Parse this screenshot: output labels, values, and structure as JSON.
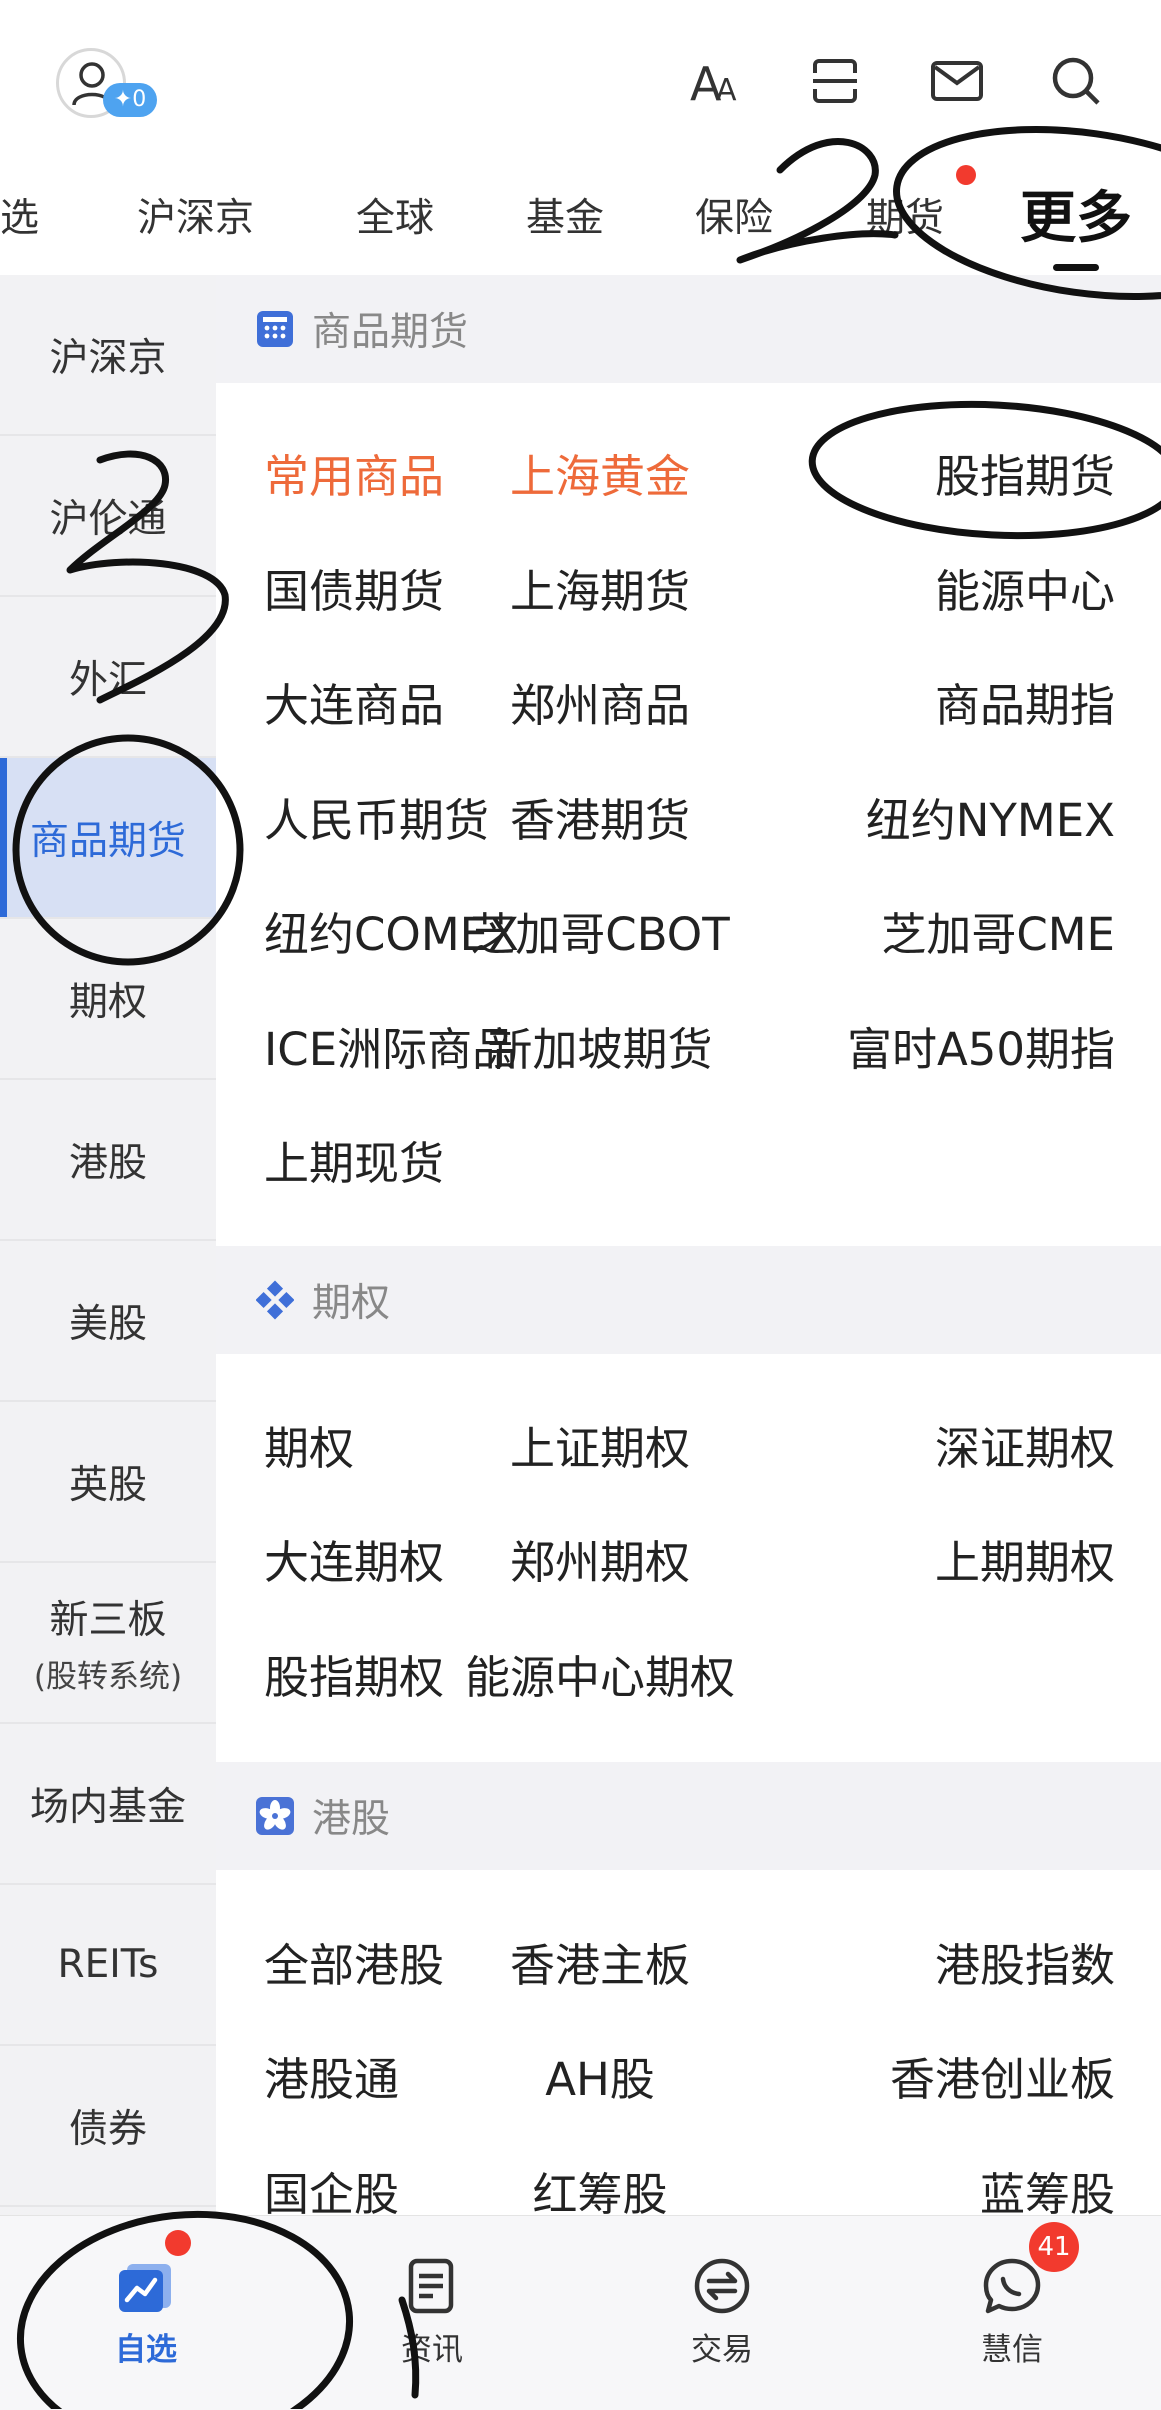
{
  "header": {
    "vip_badge": "✦0",
    "icons": [
      "user-avatar-icon",
      "font-size-icon",
      "scan-icon",
      "mail-icon",
      "search-icon"
    ]
  },
  "tabs": [
    "选",
    "沪深京",
    "全球",
    "基金",
    "保险",
    "期货",
    "更多"
  ],
  "sidebar": [
    {
      "label": "沪深京"
    },
    {
      "label": "沪伦通"
    },
    {
      "label": "外汇"
    },
    {
      "label": "商品期货",
      "active": true
    },
    {
      "label": "期权"
    },
    {
      "label": "港股"
    },
    {
      "label": "美股"
    },
    {
      "label": "英股"
    },
    {
      "label": "新三板",
      "sub": "(股转系统)"
    },
    {
      "label": "场内基金"
    },
    {
      "label": "REITs"
    },
    {
      "label": "债券"
    }
  ],
  "sections": [
    {
      "title": "商品期货",
      "icon": "calculator-grid-icon",
      "rows": [
        [
          "常用商品",
          "上海黄金",
          "股指期货"
        ],
        [
          "国债期货",
          "上海期货",
          "能源中心"
        ],
        [
          "大连商品",
          "郑州商品",
          "商品期指"
        ],
        [
          "人民币期货",
          "香港期货",
          "纽约NYMEX"
        ],
        [
          "纽约COMEX",
          "芝加哥CBOT",
          "芝加哥CME"
        ],
        [
          "ICE洲际商品",
          "新加坡期货",
          "富时A50期指"
        ],
        [
          "上期现货",
          "",
          ""
        ]
      ],
      "highlight": [
        "常用商品",
        "上海黄金"
      ]
    },
    {
      "title": "期权",
      "icon": "options-diamond-icon",
      "rows": [
        [
          "期权",
          "上证期权",
          "深证期权"
        ],
        [
          "大连期权",
          "郑州期权",
          "上期期权"
        ],
        [
          "股指期权",
          "能源中心期权",
          ""
        ]
      ]
    },
    {
      "title": "港股",
      "icon": "bauhinia-icon",
      "rows": [
        [
          "全部港股",
          "香港主板",
          "港股指数"
        ],
        [
          "港股通",
          "AH股",
          "香港创业板"
        ],
        [
          "国企股",
          "红筹股",
          "蓝筹股"
        ]
      ]
    }
  ],
  "bottom_nav": [
    {
      "label": "自选",
      "icon": "watchlist-chart-icon",
      "active": true
    },
    {
      "label": "资讯",
      "icon": "news-doc-icon"
    },
    {
      "label": "交易",
      "icon": "exchange-icon"
    },
    {
      "label": "慧信",
      "icon": "chat-icon",
      "badge": "41"
    }
  ],
  "colors": {
    "accent": "#2d6ad8",
    "hot": "#ee6a3a",
    "badge": "#f23a2e"
  }
}
